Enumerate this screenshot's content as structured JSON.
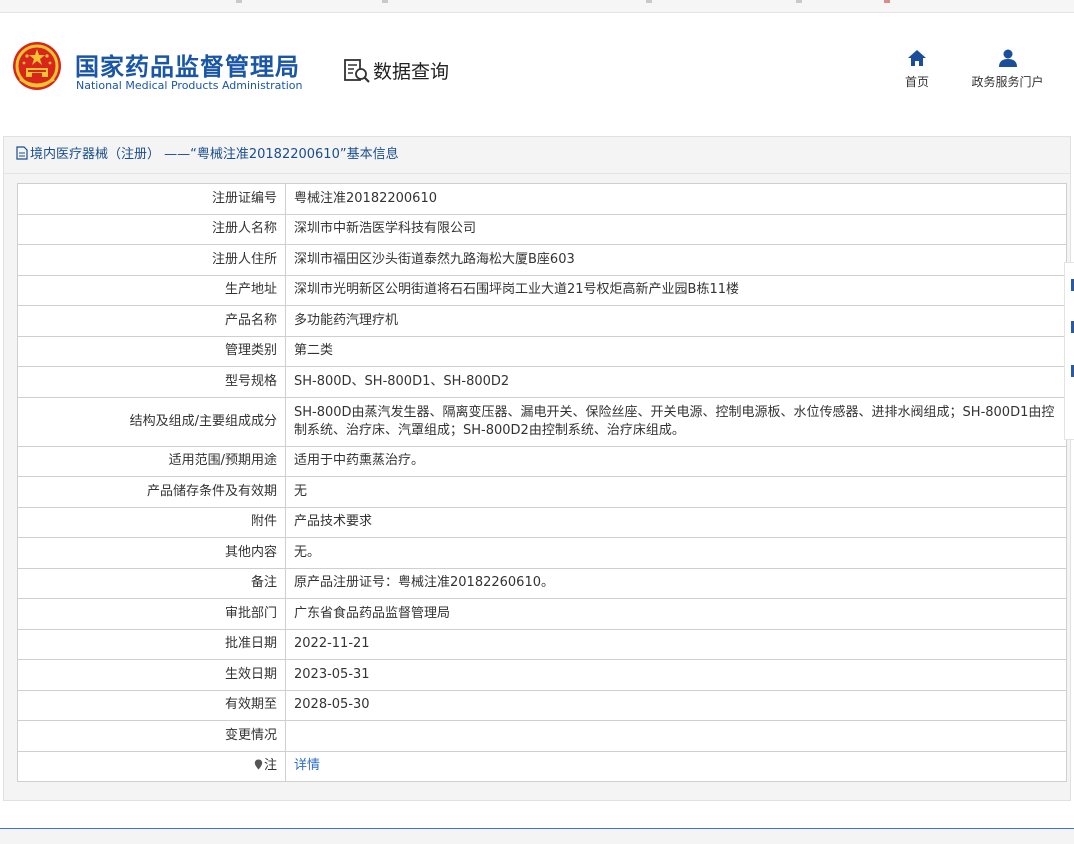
{
  "header": {
    "brand_cn": "国家药品监督管理局",
    "brand_en": "National Medical Products Administration",
    "query_title": "数据查询",
    "nav": [
      {
        "label": "首页",
        "icon": "home-icon"
      },
      {
        "label": "政务服务门户",
        "icon": "user-icon"
      }
    ]
  },
  "panel": {
    "title": "境内医疗器械（注册） ——“粤械注准20182200610”基本信息",
    "title_icon": "document-icon"
  },
  "rows": [
    {
      "key": "注册证编号",
      "value": "粤械注准20182200610"
    },
    {
      "key": "注册人名称",
      "value": "深圳市中新浩医学科技有限公司"
    },
    {
      "key": "注册人住所",
      "value": "深圳市福田区沙头街道泰然九路海松大厦B座603"
    },
    {
      "key": "生产地址",
      "value": "深圳市光明新区公明街道将石石围坪岗工业大道21号权炬高新产业园B栋11楼"
    },
    {
      "key": "产品名称",
      "value": "多功能药汽理疗机"
    },
    {
      "key": "管理类别",
      "value": "第二类"
    },
    {
      "key": "型号规格",
      "value": "SH-800D、SH-800D1、SH-800D2"
    },
    {
      "key": "结构及组成/主要组成成分",
      "value": "SH-800D由蒸汽发生器、隔离变压器、漏电开关、保险丝座、开关电源、控制电源板、水位传感器、进排水阀组成；SH-800D1由控制系统、治疗床、汽罩组成；SH-800D2由控制系统、治疗床组成。"
    },
    {
      "key": "适用范围/预期用途",
      "value": "适用于中药熏蒸治疗。"
    },
    {
      "key": "产品储存条件及有效期",
      "value": "无"
    },
    {
      "key": "附件",
      "value": "产品技术要求"
    },
    {
      "key": "其他内容",
      "value": "无。"
    },
    {
      "key": "备注",
      "value": "原产品注册证号：粤械注准20182260610。"
    },
    {
      "key": "审批部门",
      "value": "广东省食品药品监督管理局"
    },
    {
      "key": "批准日期",
      "value": "2022-11-21"
    },
    {
      "key": "生效日期",
      "value": "2023-05-31"
    },
    {
      "key": "有效期至",
      "value": "2028-05-30"
    },
    {
      "key": "变更情况",
      "value": ""
    },
    {
      "key": "注",
      "value": "详情",
      "key_icon": "pin-icon"
    }
  ],
  "colors": {
    "brand": "#1a56a8",
    "link": "#2b6cc4"
  }
}
